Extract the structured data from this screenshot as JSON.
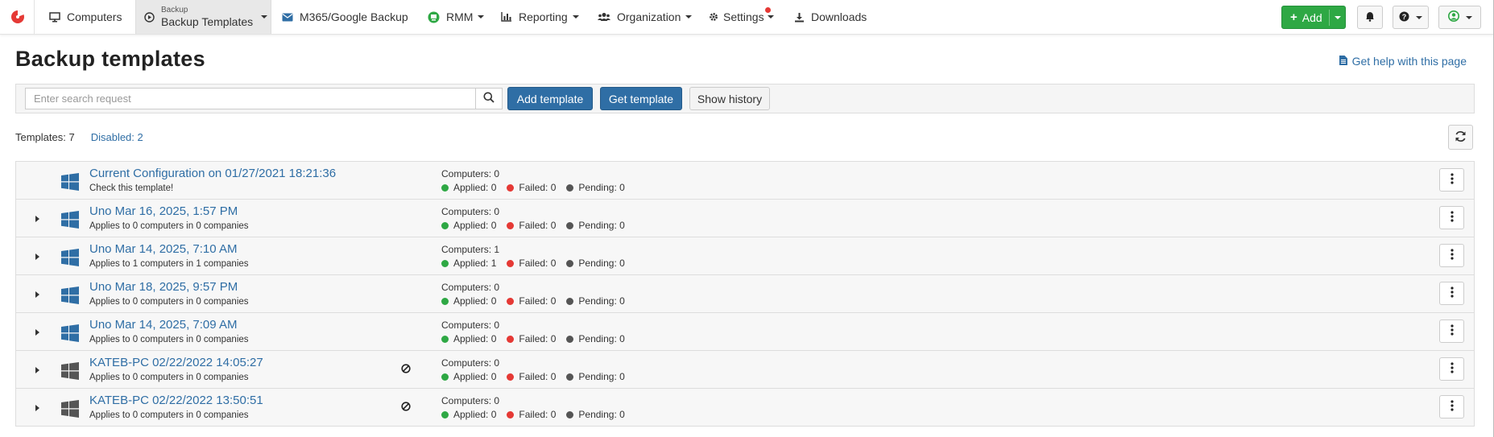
{
  "nav": {
    "computers": "Computers",
    "backup_small": "Backup",
    "backup_main": "Backup Templates",
    "m365": "M365/Google Backup",
    "rmm": "RMM",
    "reporting": "Reporting",
    "organization": "Organization",
    "settings": "Settings",
    "downloads": "Downloads",
    "add": "Add"
  },
  "page": {
    "title": "Backup templates",
    "help": "Get help with this page"
  },
  "toolbar": {
    "search_placeholder": "Enter search request",
    "add_template": "Add template",
    "get_template": "Get template",
    "show_history": "Show history"
  },
  "counts": {
    "templates": "Templates: 7",
    "disabled": "Disabled: 2"
  },
  "colors": {
    "link": "#2f6ea5",
    "applied": "#2ea844",
    "failed": "#e53935",
    "pending": "#555555",
    "windows_enabled": "#2f6ea5",
    "windows_disabled": "#555555"
  },
  "rows": [
    {
      "name": "Current Configuration on 01/27/2021 18:21:36",
      "sub": "Check this template!",
      "computers": "Computers: 0",
      "applied": "Applied: 0",
      "failed": "Failed: 0",
      "pending": "Pending: 0"
    },
    {
      "name": "Uno Mar 16, 2025, 1:57 PM",
      "sub": "Applies to 0 computers in 0 companies",
      "computers": "Computers: 0",
      "applied": "Applied: 0",
      "failed": "Failed: 0",
      "pending": "Pending: 0"
    },
    {
      "name": "Uno Mar 14, 2025, 7:10 AM",
      "sub": "Applies to 1 computers in 1 companies",
      "computers": "Computers: 1",
      "applied": "Applied: 1",
      "failed": "Failed: 0",
      "pending": "Pending: 0"
    },
    {
      "name": "Uno Mar 18, 2025, 9:57 PM",
      "sub": "Applies to 0 computers in 0 companies",
      "computers": "Computers: 0",
      "applied": "Applied: 0",
      "failed": "Failed: 0",
      "pending": "Pending: 0"
    },
    {
      "name": "Uno Mar 14, 2025, 7:09 AM",
      "sub": "Applies to 0 computers in 0 companies",
      "computers": "Computers: 0",
      "applied": "Applied: 0",
      "failed": "Failed: 0",
      "pending": "Pending: 0"
    },
    {
      "name": "KATEB-PC 02/22/2022 14:05:27",
      "sub": "Applies to 0 computers in 0 companies",
      "computers": "Computers: 0",
      "applied": "Applied: 0",
      "failed": "Failed: 0",
      "pending": "Pending: 0"
    },
    {
      "name": "KATEB-PC 02/22/2022 13:50:51",
      "sub": "Applies to 0 computers in 0 companies",
      "computers": "Computers: 0",
      "applied": "Applied: 0",
      "failed": "Failed: 0",
      "pending": "Pending: 0"
    }
  ]
}
